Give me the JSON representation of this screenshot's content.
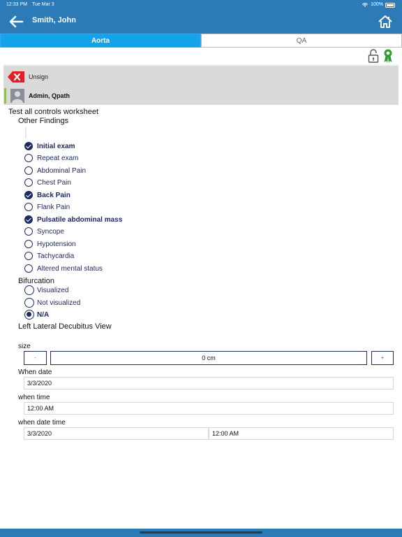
{
  "status": {
    "time": "12:33 PM",
    "date": "Tue Mar 3",
    "battery": "100%"
  },
  "header": {
    "title": "Smith, John"
  },
  "tabs": [
    {
      "label": "Aorta",
      "active": true
    },
    {
      "label": "QA",
      "active": false
    }
  ],
  "signature": {
    "unsign_label": "Unsign",
    "signer_name": "Admin, Qpath"
  },
  "worksheet": {
    "title": "Test all controls worksheet",
    "other_findings_label": "Other Findings",
    "findings": [
      {
        "label": "Initial exam",
        "checked": true
      },
      {
        "label": "Repeat exam",
        "checked": false
      },
      {
        "label": "Abdominal Pain",
        "checked": false
      },
      {
        "label": "Chest Pain",
        "checked": false
      },
      {
        "label": "Back Pain",
        "checked": true
      },
      {
        "label": "Flank Pain",
        "checked": false
      },
      {
        "label": "Pulsatile abdominal mass",
        "checked": true
      },
      {
        "label": "Syncope",
        "checked": false
      },
      {
        "label": "Hypotension",
        "checked": false
      },
      {
        "label": "Tachycardia",
        "checked": false
      },
      {
        "label": "Altered mental status",
        "checked": false
      }
    ],
    "bifurcation_label": "Bifurcation",
    "bifurcation_options": [
      {
        "label": "Visualized",
        "selected": false
      },
      {
        "label": "Not visualized",
        "selected": false
      },
      {
        "label": "N/A",
        "selected": true
      }
    ],
    "lateral_view_label": "Left Lateral Decubitus View",
    "size_label": "size",
    "size_minus": "-",
    "size_value": "0 cm",
    "size_plus": "+",
    "when_date_label": "When date",
    "when_date_value": "3/3/2020",
    "when_time_label": "when time",
    "when_time_value": "12:00 AM",
    "when_datetime_label": "when date time",
    "when_datetime_date": "3/3/2020",
    "when_datetime_time": "12:00 AM"
  },
  "colors": {
    "header_bg": "#2c7bb6",
    "tab_active": "#13a3ea",
    "control_navy": "#1f2a60"
  }
}
